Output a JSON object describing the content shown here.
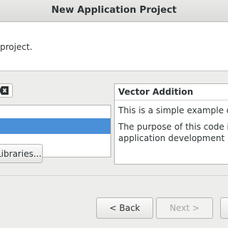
{
  "window": {
    "title": "New Application Project"
  },
  "header": {
    "description": "project."
  },
  "template_list": {
    "selected_index": 1
  },
  "buttons": {
    "libraries": "Libraries...",
    "back": "< Back",
    "next": "Next >",
    "finish": ""
  },
  "details": {
    "title": "Vector Addition",
    "paragraph1": "This is a simple example of vecto",
    "paragraph2_line1": "The purpose of this code is to i",
    "paragraph2_line2": "application development in the"
  }
}
